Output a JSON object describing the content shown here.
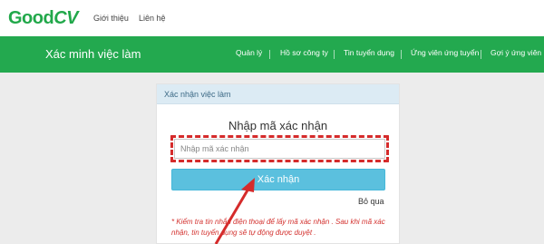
{
  "header": {
    "logo_part1": "Good",
    "logo_part2": "CV",
    "links": [
      "Giới thiệu",
      "Liên hệ"
    ]
  },
  "navbar": {
    "title": "Xác minh việc làm",
    "items": [
      "Quản lý",
      "Hồ sơ công ty",
      "Tin tuyển dụng",
      "Ứng viên ứng tuyển",
      "Gợi ý ứng viên"
    ]
  },
  "card": {
    "header_title": "Xác nhận việc làm",
    "title": "Nhập mã xác nhận",
    "input_placeholder": "Nhập mã xác nhận",
    "input_value": "",
    "confirm_button": "Xác nhận",
    "skip_link": "Bỏ qua",
    "note": "* Kiểm tra tin nhắn điện thoại để lấy mã xác nhận . Sau khi mã xác nhận, tin tuyển dụng sẽ tự động được duyệt ."
  },
  "colors": {
    "brand_green": "#23a94f",
    "button_blue": "#5bc0de",
    "highlight_red": "#d52b2b",
    "note_red": "#d3312e"
  }
}
